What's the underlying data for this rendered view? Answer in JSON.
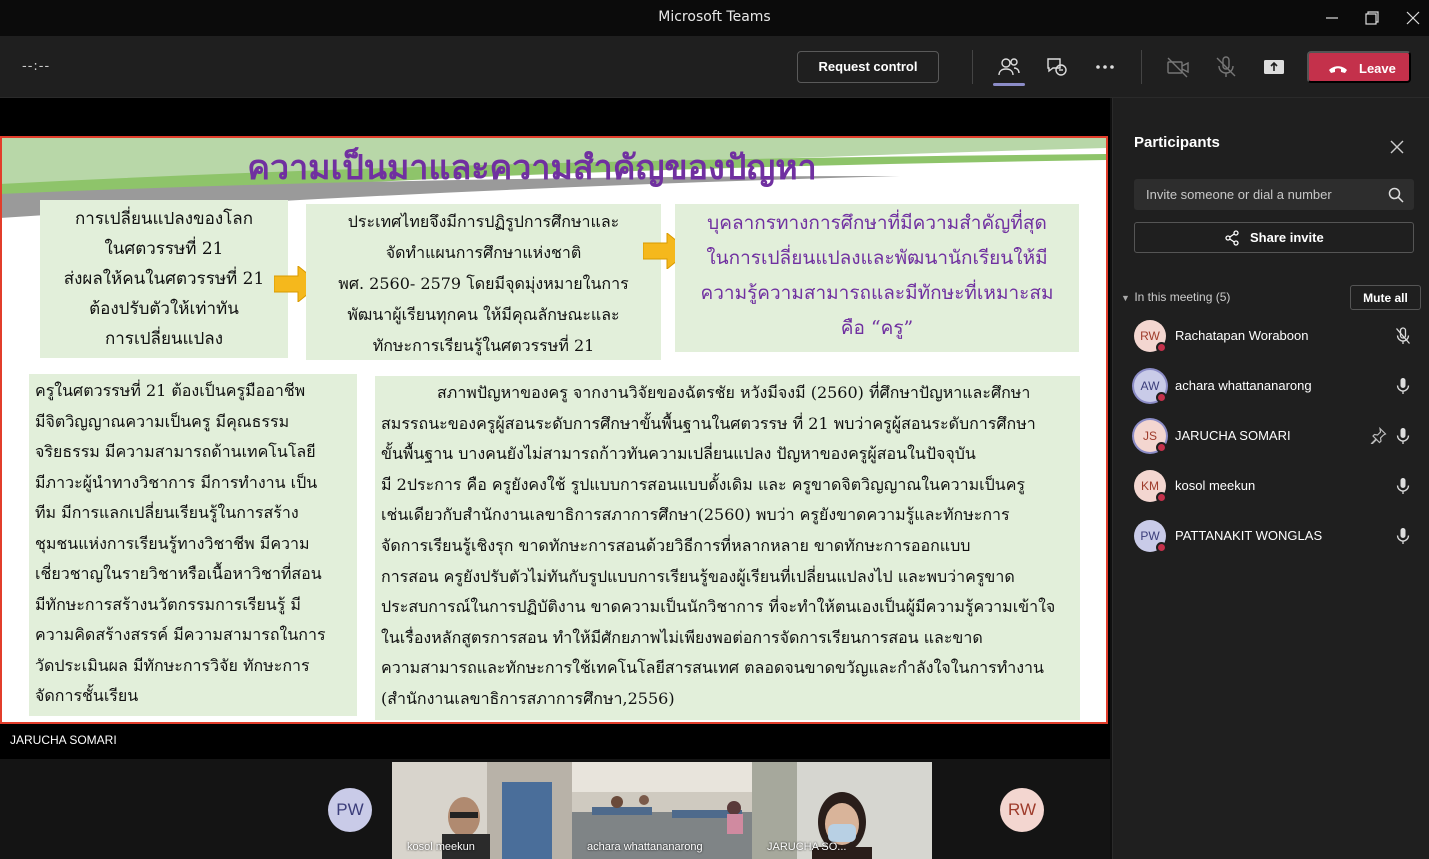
{
  "window": {
    "title": "Microsoft Teams"
  },
  "toolbar": {
    "timer": "--:--",
    "request_control_label": "Request control",
    "leave_label": "Leave",
    "icons": [
      "people-icon",
      "chat-icon",
      "more-icon",
      "camera-off-icon",
      "mic-off-icon",
      "share-screen-icon"
    ]
  },
  "slide": {
    "title": "ความเป็นมาและความสำคัญของปัญหา",
    "box1_lines": [
      "การเปลี่ยนแปลงของโลก",
      "ในศตวรรษที่ 21",
      "ส่งผลให้คนในศตวรรษที่ 21",
      "ต้องปรับตัวให้เท่าทัน",
      "การเปลี่ยนแปลง"
    ],
    "box2_lines": [
      "ประเทศไทยจึงมีการปฏิรูปการศึกษาและ",
      "จัดทำแผนการศึกษาแห่งชาติ",
      "พศ. 2560- 2579 โดยมีจุดมุ่งหมายในการ",
      "พัฒนาผู้เรียนทุกคน ให้มีคุณลักษณะและ",
      "ทักษะการเรียนรู้ในศตวรรษที่ 21"
    ],
    "box3_lines": [
      "บุคลากรทางการศึกษาที่มีความสำคัญที่สุด",
      "ในการเปลี่ยนแปลงและพัฒนานักเรียนให้มี",
      "ความรู้ความสามารถและมีทักษะที่เหมาะสม",
      "คือ “ครู”"
    ],
    "box4_lines": [
      "ครูในศตวรรษที่ 21 ต้องเป็นครูมืออาชีพ",
      " มีจิตวิญญาณความเป็นครู มีคุณธรรม",
      "จริยธรรม มีความสามารถด้านเทคโนโลยี",
      "มีภาวะผู้นำทางวิชาการ มีการทำงาน  เป็น",
      "ทีม มีการแลกเปลี่ยนเรียนรู้ในการสร้าง",
      "ชุมชนแห่งการเรียนรู้ทางวิชาชีพ มีความ",
      "เชี่ยวชาญในรายวิชาหรือเนื้อหาวิชาที่สอน",
      "มีทักษะการสร้างนวัตกรรมการเรียนรู้ มี",
      "ความคิดสร้างสรรค์ มีความสามารถในการ",
      "วัดประเมินผล  มีทักษะการวิจัย ทักษะการ",
      "จัดการชั้นเรียน"
    ],
    "box5_lines": [
      "สภาพปัญหาของครู จากงานวิจัยของฉัตรชัย หวังมีจงมี (2560) ที่ศึกษาปัญหาและศึกษา",
      "สมรรถนะของครูผู้สอนระดับการศึกษาขั้นพื้นฐานในศตวรรษ ที่ 21 พบว่าครูผู้สอนระดับการศึกษา",
      "ขั้นพื้นฐาน บางคนยังไม่สามารถก้าวทันความเปลี่ยนแปลง ปัญหาของครูผู้สอนในปัจจุบัน",
      "มี 2ประการ คือ ครูยังคงใช้ รูปแบบการสอนแบบดั้งเดิม และ ครูขาดจิตวิญญาณในความเป็นครู",
      "เช่นเดียวกับสำนักงานเลขาธิการสภาการศึกษา(2560) พบว่า ครูยังขาดความรู้และทักษะการ",
      "จัดการเรียนรู้เชิงรุก ขาดทักษะการสอนด้วยวิธีการที่หลากหลาย ขาดทักษะการออกแบบ",
      "การสอน ครูยังปรับตัวไม่ทันกับรูปแบบการเรียนรู้ของผู้เรียนที่เปลี่ยนแปลงไป และพบว่าครูขาด",
      "ประสบการณ์ในการปฏิบัติงาน ขาดความเป็นนักวิชาการ ที่จะทำให้ตนเองเป็นผู้มีความรู้ความเข้าใจ",
      "ในเรื่องหลักสูตรการสอน ทำให้มีศักยภาพไม่เพียงพอต่อการจัดการเรียนการสอน และขาด",
      "ความสามารถและทักษะการใช้เทคโนโลยีสารสนเทศ ตลอดจนขาดขวัญและกำลังใจในการทำงาน",
      "(สำนักงานเลขาธิการสภาการศึกษา,2556)"
    ],
    "presenter_name": "JARUCHA SOMARI"
  },
  "panel": {
    "title": "Participants",
    "invite_placeholder": "Invite someone or dial a number",
    "share_invite_label": "Share invite",
    "section_label": "In this meeting (5)",
    "mute_all_label": "Mute all",
    "participants": [
      {
        "initials": "RW",
        "name": "Rachatapan Woraboon",
        "bg": "#f3d6d0",
        "fg": "#9e3b2b",
        "mic": "muted"
      },
      {
        "initials": "AW",
        "name": "achara whattananarong",
        "bg": "#c9cbe8",
        "fg": "#3b3d7a",
        "mic": "on"
      },
      {
        "initials": "JS",
        "name": "JARUCHA SOMARI",
        "bg": "#f3d6d0",
        "fg": "#9e3b2b",
        "mic": "on"
      },
      {
        "initials": "KM",
        "name": "kosol meekun",
        "bg": "#f3d6d0",
        "fg": "#9e3b2b",
        "mic": "on"
      },
      {
        "initials": "PW",
        "name": "PATTANAKIT WONGLAS",
        "bg": "#c9cbe8",
        "fg": "#3b3d7a",
        "mic": "on"
      }
    ]
  },
  "strip": {
    "left_avatar": "PW",
    "right_avatar": "RW",
    "tiles": [
      {
        "name": "kosol meekun"
      },
      {
        "name": "achara whattananarong"
      },
      {
        "name": "JARUCHA SO..."
      }
    ]
  },
  "colors": {
    "leave": "#c4314b",
    "accent": "#8b8cc7",
    "slide_title": "#7030a0",
    "slide_box": "#e2efda",
    "slide_border": "#e23d2b",
    "arrow": "#f5b81c"
  }
}
